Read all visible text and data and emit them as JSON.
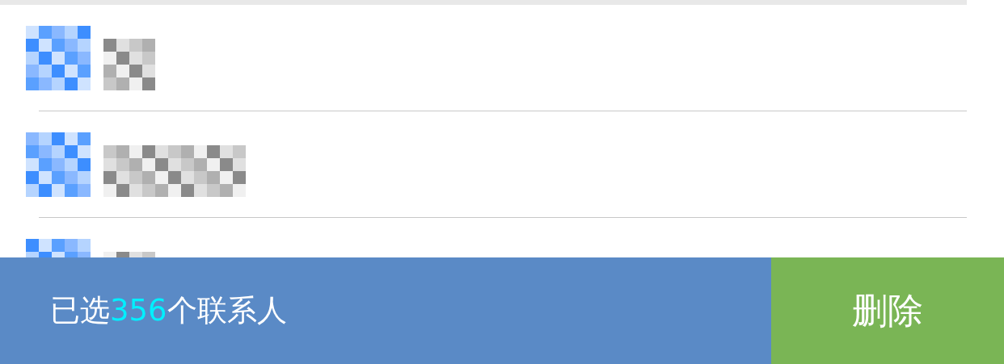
{
  "contact_rows": [
    {
      "kind": "pixelated"
    },
    {
      "kind": "pixelated_long"
    },
    {
      "kind": "pixelated"
    }
  ],
  "selection_bar": {
    "prefix": "已选",
    "count": "356",
    "suffix": "个联系人"
  },
  "delete_button": {
    "label": "删除"
  }
}
